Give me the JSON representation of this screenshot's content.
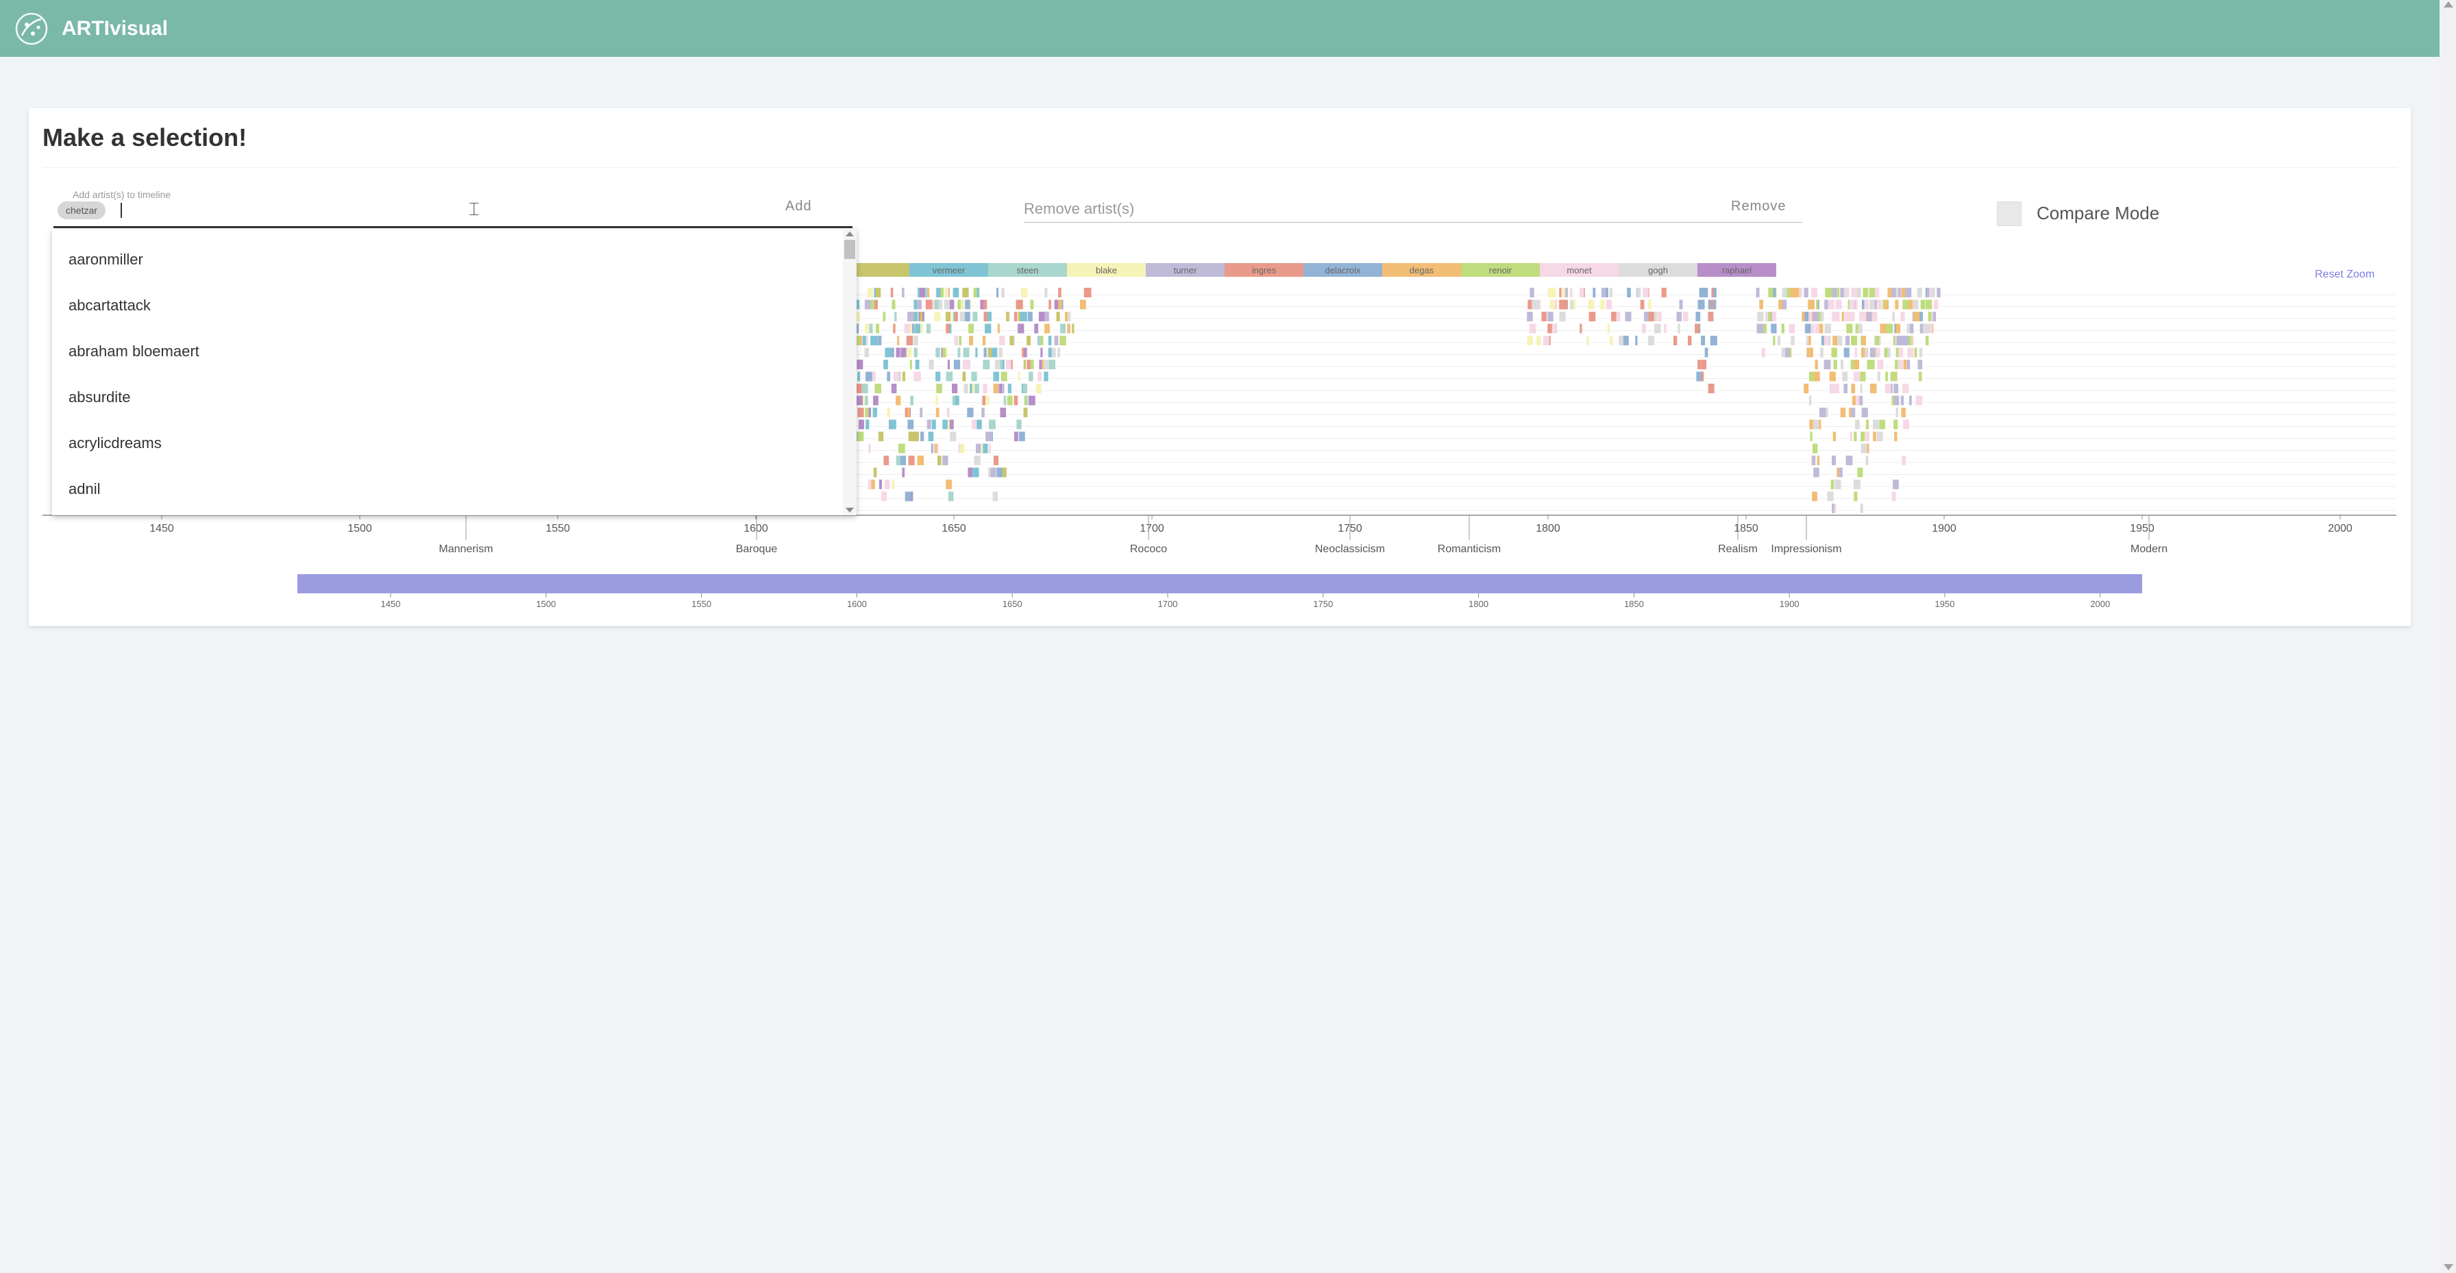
{
  "app": {
    "title": "ARTIvisual"
  },
  "selection": {
    "title": "Make a selection!",
    "add_label": "Add artist(s) to timeline",
    "add_chip": "chetzar",
    "add_button": "Add",
    "remove_placeholder": "Remove artist(s)",
    "remove_button": "Remove",
    "compare_label": "Compare Mode",
    "compare_checked": false
  },
  "dropdown": {
    "options": [
      "aaronmiller",
      "abcartattack",
      "abraham bloemaert",
      "absurdite",
      "acrylicdreams",
      "adnil"
    ]
  },
  "timeline": {
    "reset_zoom_label": "Reset Zoom",
    "legend": [
      {
        "name": "",
        "color": "#c9c56e"
      },
      {
        "name": "vermeer",
        "color": "#7fc4d4"
      },
      {
        "name": "steen",
        "color": "#a9d6cd"
      },
      {
        "name": "blake",
        "color": "#f6f3b8"
      },
      {
        "name": "turner",
        "color": "#bfbad8"
      },
      {
        "name": "ingres",
        "color": "#ea9a8a"
      },
      {
        "name": "delacroix",
        "color": "#92b3d5"
      },
      {
        "name": "degas",
        "color": "#f2bd74"
      },
      {
        "name": "renoir",
        "color": "#bfdc7e"
      },
      {
        "name": "monet",
        "color": "#f6d8e6"
      },
      {
        "name": "gogh",
        "color": "#dcdcdc"
      },
      {
        "name": "raphael",
        "color": "#b78ec8"
      }
    ],
    "axis_ticks": [
      "1450",
      "1500",
      "1550",
      "1600",
      "1650",
      "1700",
      "1750",
      "1800",
      "1850",
      "1900",
      "1950",
      "2000"
    ],
    "movements": [
      "Mannerism",
      "Baroque",
      "Rococo",
      "Neoclassicism",
      "Romanticism",
      "Realism",
      "Impressionism",
      "Modern"
    ],
    "brush_ticks": [
      "1450",
      "1500",
      "1550",
      "1600",
      "1650",
      "1700",
      "1750",
      "1800",
      "1850",
      "1900",
      "1950",
      "2000"
    ],
    "brush_color": "#9b9be0"
  }
}
